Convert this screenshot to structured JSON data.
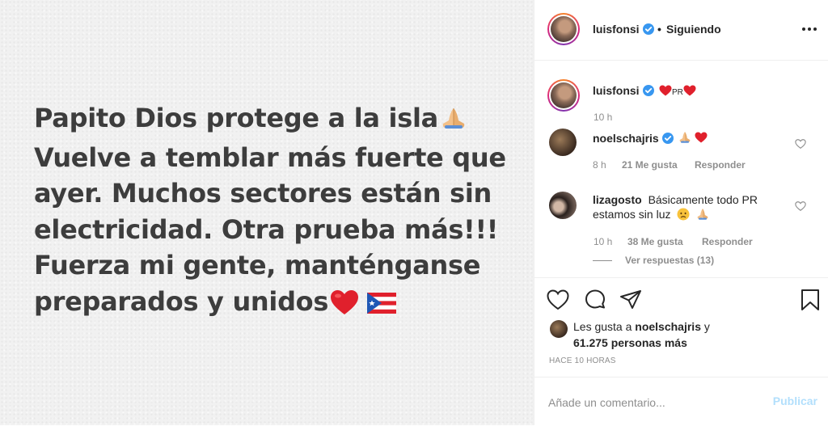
{
  "post": {
    "lines": [
      "Papito Dios protege a la isla",
      "Vuelve a temblar más fuerte que",
      "ayer. Muchos sectores están sin",
      "electricidad. Otra prueba más!!!",
      "Fuerza mi gente, manténganse",
      "preparados y unidos"
    ],
    "emojis": [
      "praying-hands",
      "red-heart",
      "puerto-rico-flag"
    ]
  },
  "header": {
    "username": "luisfonsi",
    "separator": "•",
    "follow_status": "Siguiendo"
  },
  "caption": {
    "username": "luisfonsi",
    "mid_text": "PR",
    "time": "10 h"
  },
  "comments": [
    {
      "username": "noelschajris",
      "time": "8 h",
      "likes": "21 Me gusta",
      "reply": "Responder"
    },
    {
      "username": "lizagosto",
      "text_line1": "Básicamente todo PR",
      "text_line2": "estamos sin luz",
      "time": "10 h",
      "likes": "38 Me gusta",
      "reply": "Responder",
      "view_replies": "Ver respuestas (13)"
    }
  ],
  "likes_summary": {
    "prefix": "Les gusta a",
    "user": "noelschajris",
    "conj": "y",
    "others": "61.275 personas más"
  },
  "time_ago": "HACE 10 HORAS",
  "add_comment": {
    "placeholder": "Añade un comentario...",
    "publish": "Publicar"
  },
  "colors": {
    "verified": "#3897f0",
    "heart": "#ed4956",
    "publish_disabled": "#b2dffc",
    "muted": "#8e8e8e"
  }
}
